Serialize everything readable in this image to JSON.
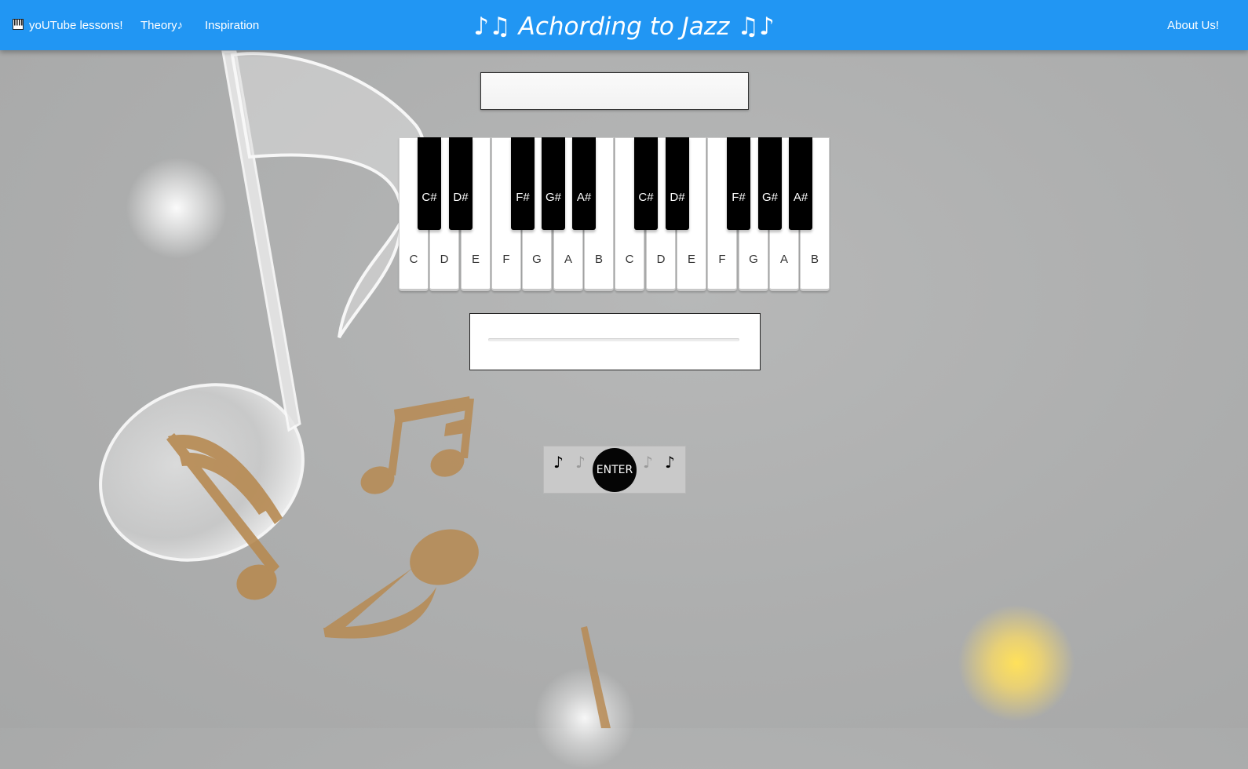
{
  "nav": {
    "youtube_label": "yoUTube lessons!",
    "theory_label": "Theory♪",
    "inspiration_label": "Inspiration",
    "about_label": "About Us!",
    "piano_icon": "piano-icon"
  },
  "brand": {
    "title": "♪♫ Achording to Jazz ♫♪"
  },
  "chord_display": {
    "value": ""
  },
  "answer": {
    "value": "",
    "placeholder": ""
  },
  "piano": {
    "white_keys": [
      "C",
      "D",
      "E",
      "F",
      "G",
      "A",
      "B",
      "C",
      "D",
      "E",
      "F",
      "G",
      "A",
      "B"
    ],
    "black_keys": [
      "C#",
      "D#",
      "F#",
      "G#",
      "A#",
      "C#",
      "D#",
      "F#",
      "G#",
      "A#"
    ]
  },
  "enter": {
    "label": "ENTER",
    "notes": [
      "♪",
      "♪",
      "♪",
      "♪"
    ]
  },
  "colors": {
    "navbar": "#2196f3",
    "background": "#adaeae",
    "note_gold": "#b78a52",
    "sun_glow": "#fbe070"
  }
}
